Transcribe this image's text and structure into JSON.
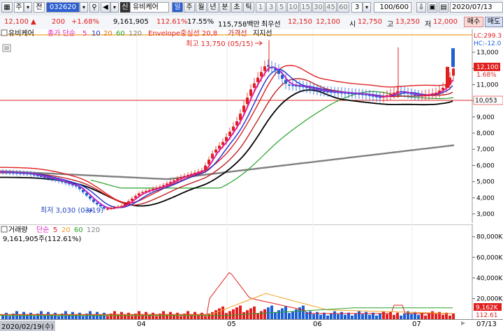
{
  "toolbar": {
    "type_short": "주",
    "mode": "전",
    "code": "032620",
    "sin_badge": "신",
    "stock_name": "유비케어",
    "periods": [
      "일",
      "주",
      "월",
      "년",
      "분",
      "초",
      "틱"
    ],
    "intervals": [
      "1",
      "3",
      "5",
      "10",
      "15",
      "30",
      "45",
      "60"
    ],
    "interval_value": "3",
    "count": "100/600",
    "date": "2020/07/13"
  },
  "infobar": {
    "price": "12,100",
    "change": "200",
    "change_pct": "+1.68%",
    "volume": "9,161,905",
    "vol_pct": "112.61%",
    "turnover": "17.55%",
    "amount": "115,758백만",
    "best_ask_label": "최우선",
    "best_ask": "12,150",
    "best_bid": "12,100",
    "open_label": "시",
    "open": "12,750",
    "high_label": "고",
    "high": "13,250",
    "low_label": "저",
    "low": "12,000",
    "sell_btn": "매수",
    "buy_btn": "매도"
  },
  "legend": {
    "name": "유비케어",
    "ma_label": "종가 단순",
    "ma_periods": [
      "5",
      "10",
      "20",
      "60",
      "120"
    ],
    "envelope": "Envelope중심선 20,8",
    "envelope2": "가격선",
    "envelope3": "지지선"
  },
  "annotations": {
    "high": "최고 13,750 (05/15)",
    "low": "최저 3,030 (03/19)"
  },
  "price_axis": {
    "lc": "LC:299.3",
    "hc": "HC:-12.0",
    "ticks": [
      "13,000",
      "12,000",
      "11,000",
      "10,000",
      "9,000",
      "8,000",
      "7,000",
      "6,000",
      "5,000",
      "4,000",
      "3,000"
    ],
    "current": "12,100",
    "current_pct": "1.68%",
    "ref": "10,053"
  },
  "volume": {
    "label": "거래량",
    "ma_label": "단순",
    "ma_periods": [
      "5",
      "20",
      "60",
      "120"
    ],
    "value": "9,161,905주(112.61%)",
    "ticks": [
      "80,000K",
      "60,000K",
      "40,000K",
      "20,000K"
    ],
    "current": "9,162K",
    "current_pct": "112.61"
  },
  "dates": {
    "start": "2020/02/19(수)",
    "labels": [
      "04",
      "05",
      "06",
      "07"
    ],
    "end": "07/13"
  },
  "colors": {
    "up": "#e0201f",
    "down": "#1e5fd6",
    "ma5": "#e01fbf",
    "ma10": "#1a2fd0",
    "ma20": "#e0701f",
    "ma60": "#28a028",
    "ma120": "#808080",
    "highlight": "#2c5fd0"
  }
}
